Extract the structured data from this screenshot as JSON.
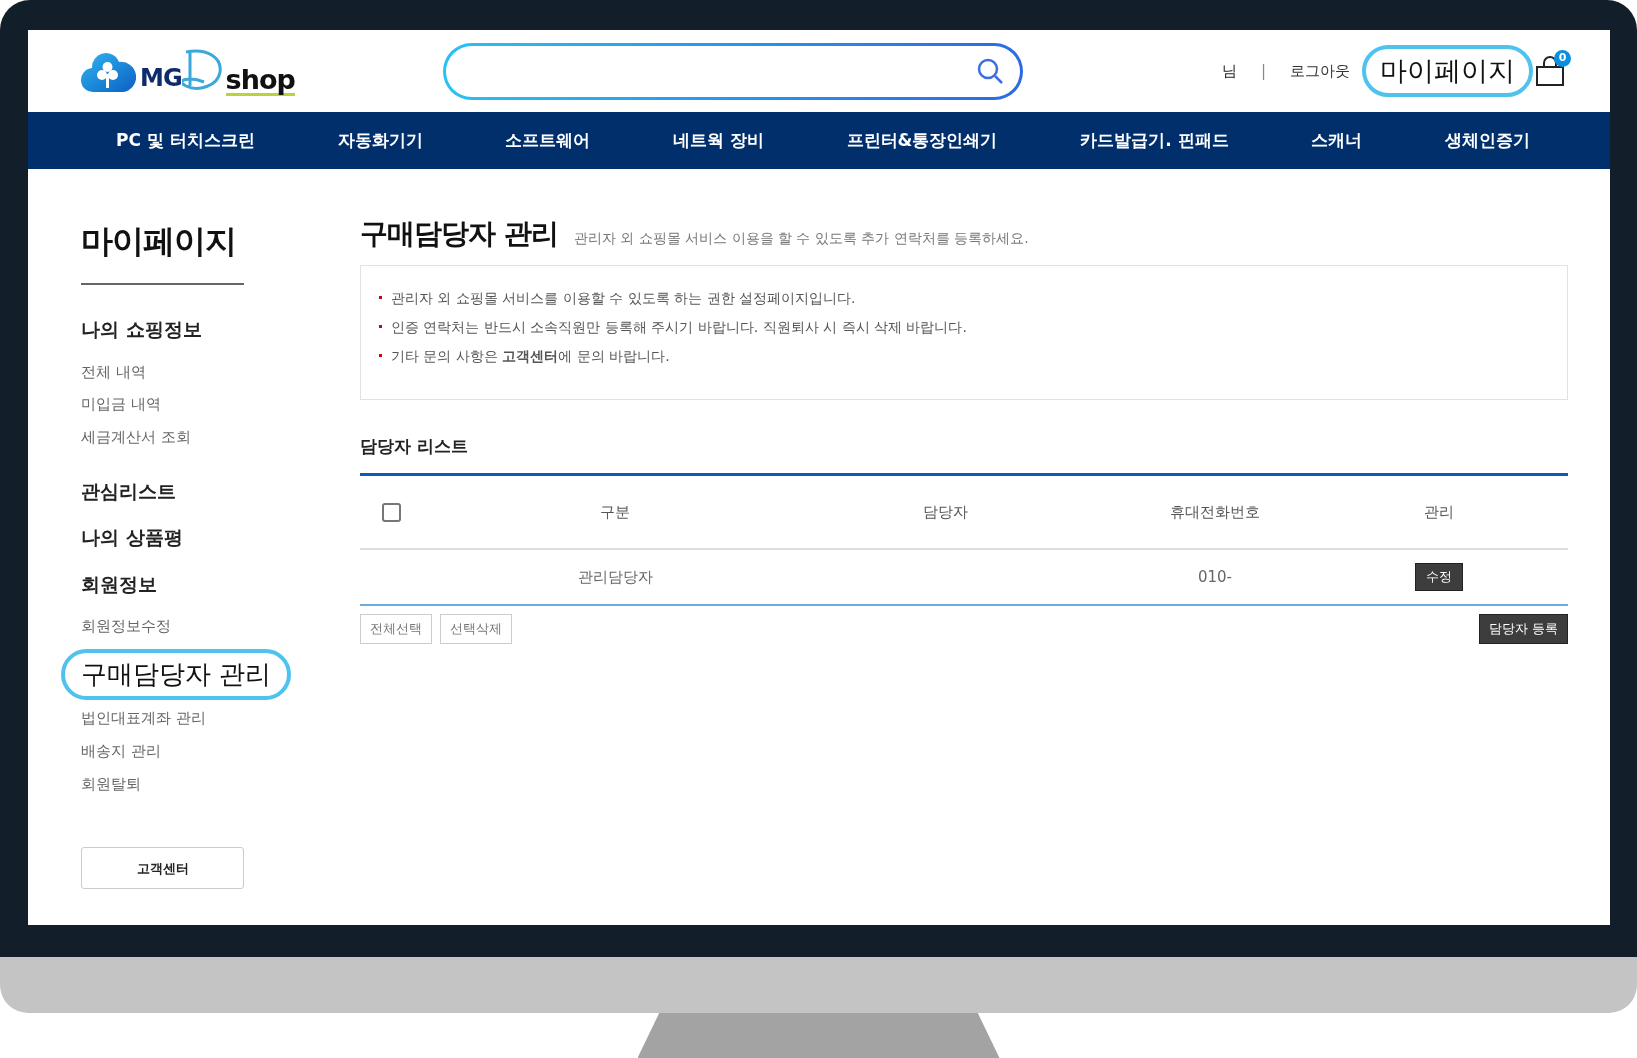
{
  "header": {
    "logo": [
      "MG",
      "shop"
    ],
    "user_links": [
      {
        "label": "님",
        "kind": "text",
        "highlighted": false
      },
      {
        "label": "|",
        "kind": "separator",
        "highlighted": false
      },
      {
        "label": "로그아웃",
        "kind": "link",
        "highlighted": false
      },
      {
        "label": "마이페이지",
        "kind": "link",
        "highlighted": true
      }
    ],
    "cart_count": "0"
  },
  "nav": [
    "PC 및 터치스크린",
    "자동화기기",
    "소프트웨어",
    "네트웍 장비",
    "프린터&통장인쇄기",
    "카드발급기. 핀패드",
    "스캐너",
    "생체인증기"
  ],
  "sidebar": {
    "title": "마이페이지",
    "sections": [
      {
        "heading": "나의 쇼핑정보",
        "items": [
          {
            "label": "전체 내역",
            "highlighted": false
          },
          {
            "label": "미입금 내역",
            "highlighted": false
          },
          {
            "label": "세금계산서 조회",
            "highlighted": false
          }
        ]
      },
      {
        "heading": "관심리스트"
      },
      {
        "heading": "나의 상품평"
      },
      {
        "heading": "회원정보",
        "items": [
          {
            "label": "회원정보수정",
            "highlighted": false
          },
          {
            "label": "구매담당자 관리",
            "highlighted": true
          },
          {
            "label": "법인대표계좌 관리",
            "highlighted": false
          },
          {
            "label": "배송지 관리",
            "highlighted": false
          },
          {
            "label": "회원탈퇴",
            "highlighted": false
          }
        ]
      }
    ],
    "button": "고객센터"
  },
  "page": {
    "title": "구매담당자 관리",
    "subtitle": "관리자 외 쇼핑몰 서비스 이용을 할 수 있도록 추가 연락처를 등록하세요.",
    "notices": [
      "관리자 외 쇼핑몰 서비스를 이용할 수 있도록 하는 권한 설정페이지입니다.",
      "인증 연락처는 반드시 소속직원만 등록해 주시기 바랍니다. 직원퇴사 시 즉시 삭제 바랍니다.",
      "기타 문의 사항은 **고객센터**에 문의 바랍니다."
    ],
    "list_title": "담당자 리스트",
    "table": {
      "select_all": {
        "checked": false
      },
      "columns": [
        "구분",
        "담당자",
        "휴대전화번호",
        "관리"
      ],
      "rows": [
        {
          "category": "관리담당자",
          "phone": "010-",
          "action": "수정"
        }
      ]
    },
    "left_buttons": [
      "전체선택",
      "선택삭제"
    ],
    "right_button": "담당자 등록"
  }
}
